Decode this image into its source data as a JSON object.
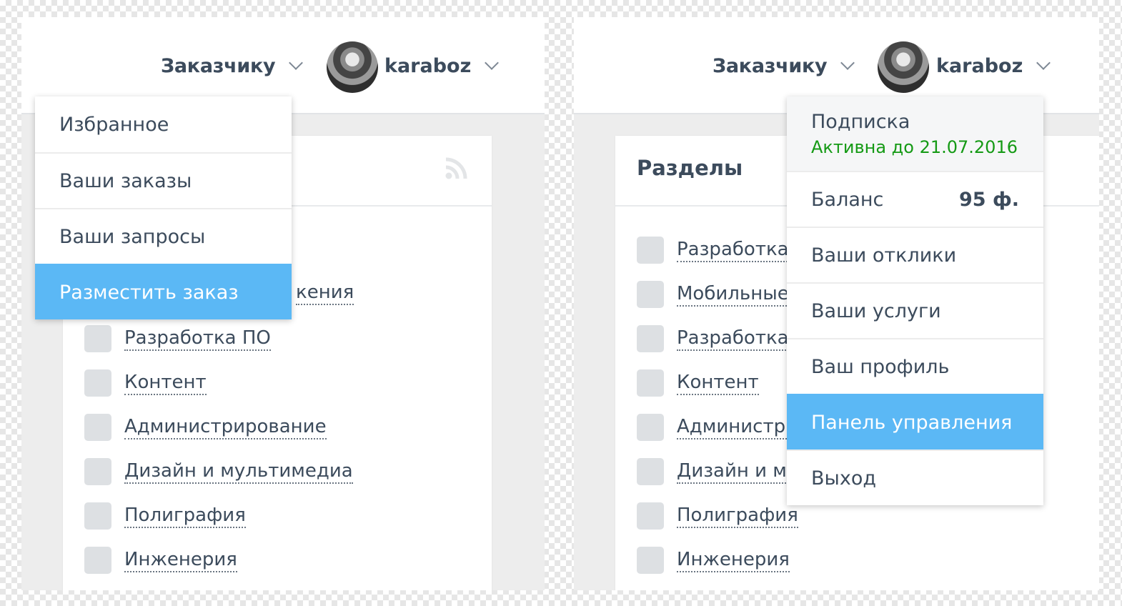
{
  "left": {
    "nav_customer": "Заказчику",
    "username": "karaboz",
    "customer_menu": [
      "Избранное",
      "Ваши заказы",
      "Ваши запросы",
      "Разместить заказ"
    ],
    "customer_menu_active": "Разместить заказ",
    "partial_hidden_label": "кения",
    "categories": [
      "Разработка ПО",
      "Контент",
      "Администрирование",
      "Дизайн и мультимедиа",
      "Полиграфия",
      "Инженерия"
    ]
  },
  "right": {
    "nav_customer": "Заказчику",
    "username": "karaboz",
    "card_title": "Разделы",
    "categories": [
      "Разработка с",
      "Мобильные п",
      "Разработка П",
      "Контент",
      "Администрир",
      "Дизайн и му",
      "Полиграфия",
      "Инженерия"
    ],
    "subscription_title": "Подписка",
    "subscription_status": "Активна до 21.07.2016",
    "balance_label": "Баланс",
    "balance_value": "95 ф.",
    "user_menu": [
      "Ваши отклики",
      "Ваши услуги",
      "Ваш профиль",
      "Панель управления",
      "Выход"
    ],
    "user_menu_active": "Панель управления"
  },
  "icons": [
    "chevron-down-icon",
    "avatar",
    "rss-icon"
  ],
  "colors": {
    "accent": "#5bb8f5",
    "subscription_active": "#159a15",
    "text": "#3c4b5c",
    "checkbox": "#dde0e3"
  }
}
